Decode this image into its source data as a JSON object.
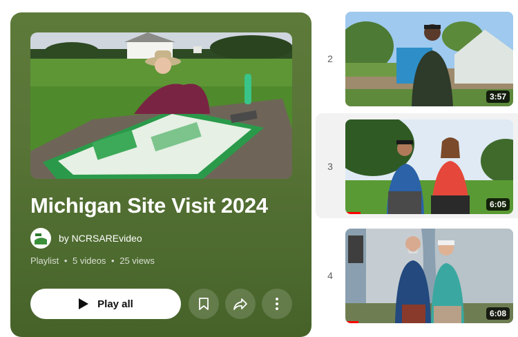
{
  "playlist": {
    "title": "Michigan Site Visit 2024",
    "channel": "by NCRSAREvideo",
    "type": "Playlist",
    "video_count": "5 videos",
    "views": "25 views",
    "meta_sep": "•",
    "play_all_label": "Play all",
    "accent_color": "#587436"
  },
  "icons": {
    "play": "play-icon",
    "save": "bookmark-icon",
    "share": "share-icon",
    "more": "more-vert-icon"
  },
  "videos": [
    {
      "index": "2",
      "duration": "3:57",
      "watched_fraction": 0
    },
    {
      "index": "3",
      "duration": "6:05",
      "watched_fraction": 0.09
    },
    {
      "index": "4",
      "duration": "6:08",
      "watched_fraction": 0.08
    }
  ]
}
